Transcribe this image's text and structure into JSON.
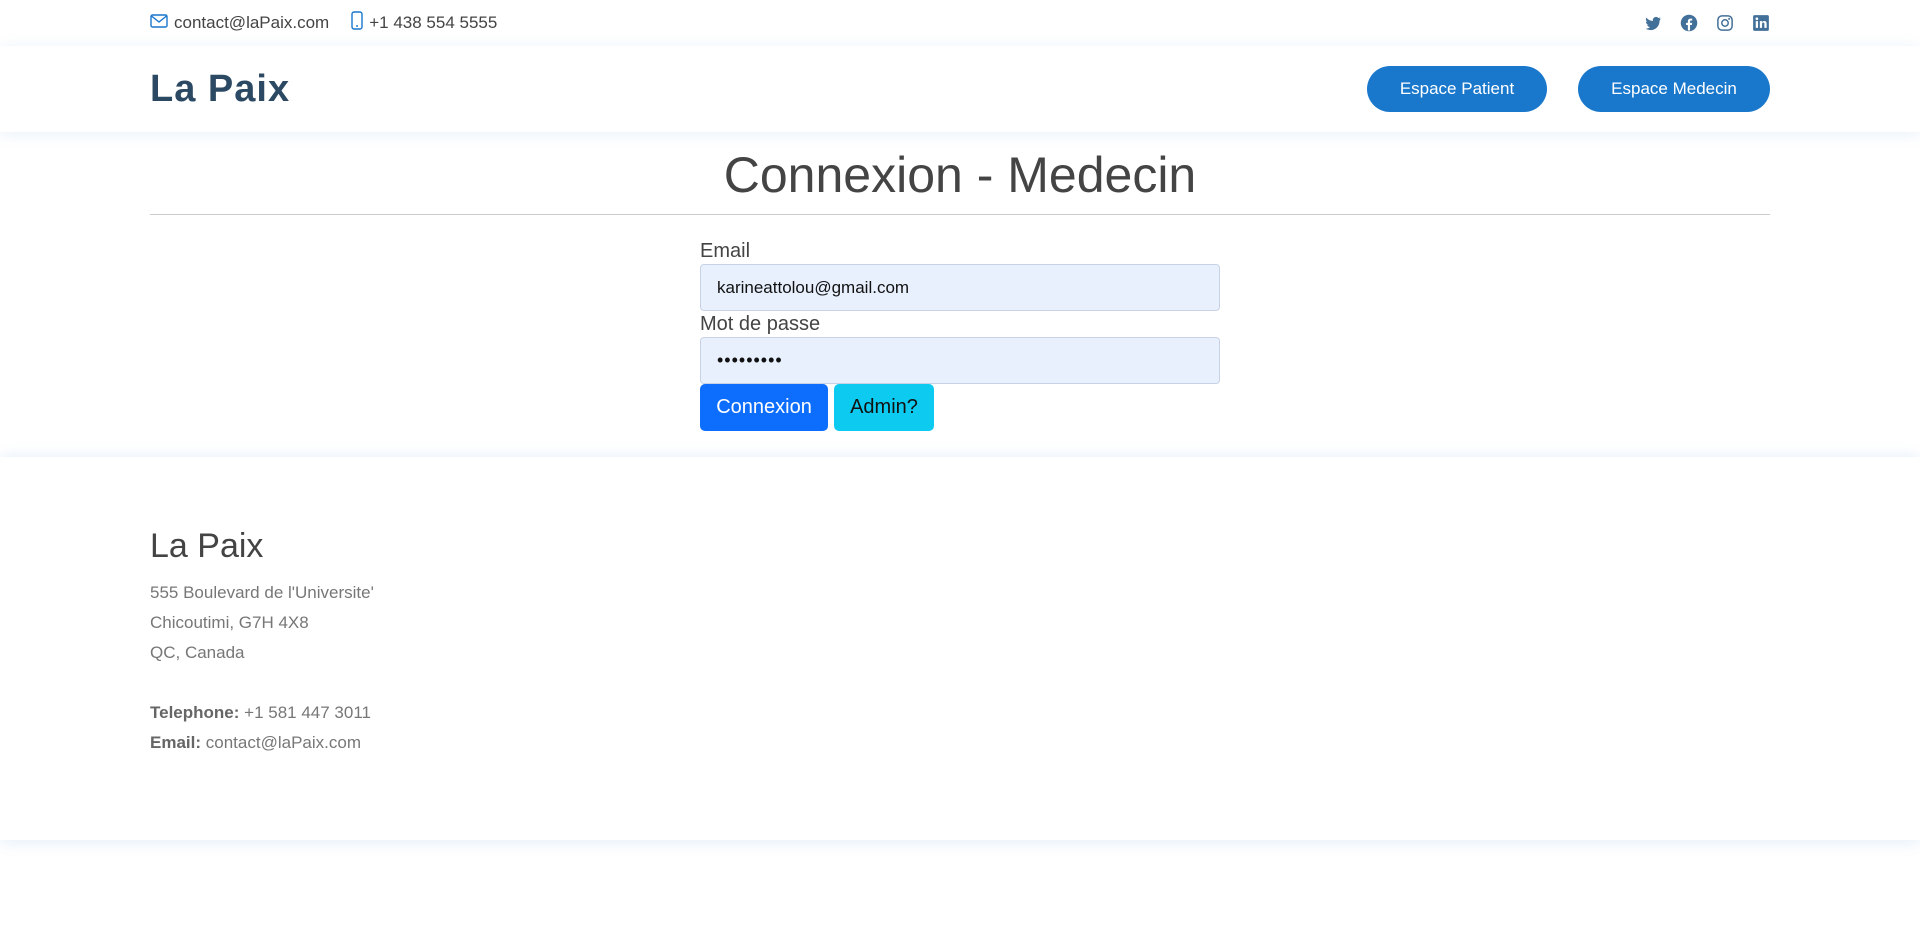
{
  "topbar": {
    "email": "contact@laPaix.com",
    "phone": "+1 438 554 5555",
    "social": [
      "twitter-icon",
      "facebook-icon",
      "instagram-icon",
      "linkedin-icon"
    ]
  },
  "header": {
    "logo": "La Paix",
    "nav": {
      "patient": "Espace Patient",
      "medecin": "Espace Medecin"
    }
  },
  "login": {
    "title": "Connexion - Medecin",
    "email_label": "Email",
    "email_value": "karineattolou@gmail.com",
    "password_label": "Mot de passe",
    "password_value": "•••••••••",
    "submit_label": "Connexion",
    "admin_label": "Admin?"
  },
  "footer": {
    "name": "La Paix",
    "address_line1": "555 Boulevard de l'Universite'",
    "address_line2": "Chicoutimi, G7H 4X8",
    "address_line3": "QC, Canada",
    "phone_label": "Telephone:",
    "phone_value": "+1 581 447 3011",
    "email_label": "Email:",
    "email_value": "contact@laPaix.com"
  },
  "colors": {
    "brand": "#1977cc",
    "logo": "#2c4964",
    "primary_button": "#0d6efd",
    "info_button": "#0dcaf0",
    "autofill": "#e8f0fe"
  }
}
